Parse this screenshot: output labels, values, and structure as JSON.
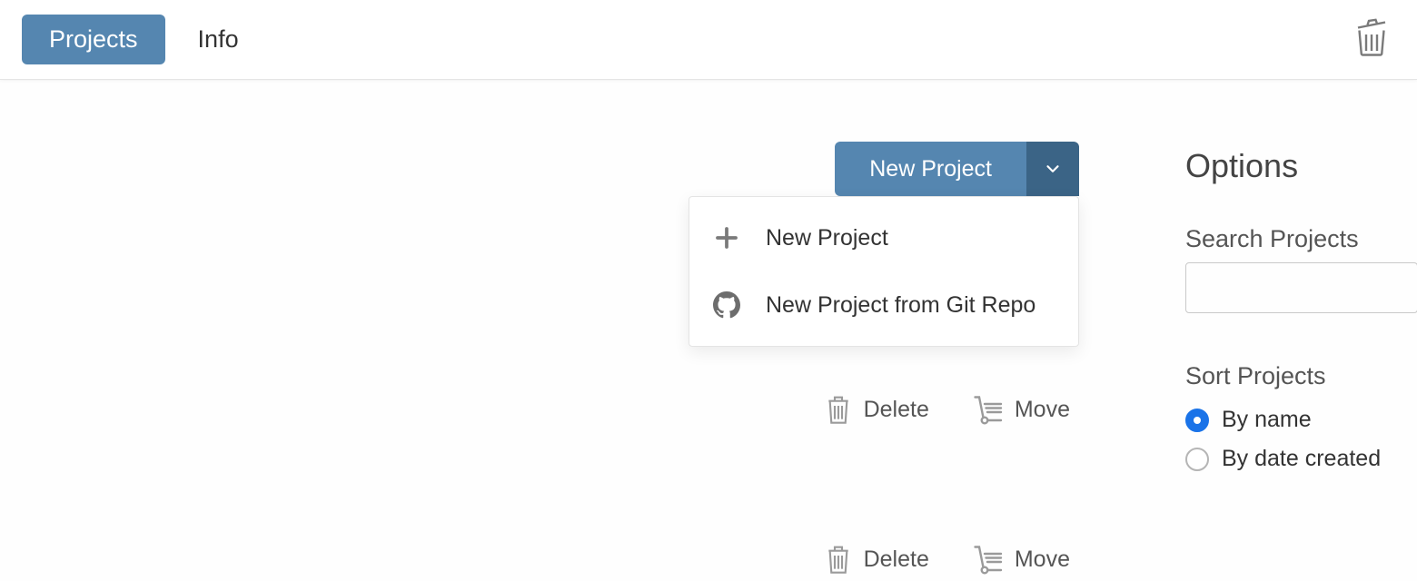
{
  "topbar": {
    "tabs": [
      {
        "label": "Projects",
        "active": true
      },
      {
        "label": "Info",
        "active": false
      }
    ],
    "trash_icon": "trash-icon"
  },
  "new_project": {
    "main_label": "New Project",
    "menu": [
      {
        "icon": "plus",
        "label": "New Project"
      },
      {
        "icon": "github",
        "label": "New Project from Git Repo"
      }
    ]
  },
  "project_actions": {
    "delete_label": "Delete",
    "move_label": "Move"
  },
  "sidebar": {
    "options_title": "Options",
    "search_label": "Search Projects",
    "search_placeholder": "",
    "sort_label": "Sort Projects",
    "sort_options": [
      {
        "label": "By name",
        "checked": true
      },
      {
        "label": "By date created",
        "checked": false
      }
    ]
  }
}
